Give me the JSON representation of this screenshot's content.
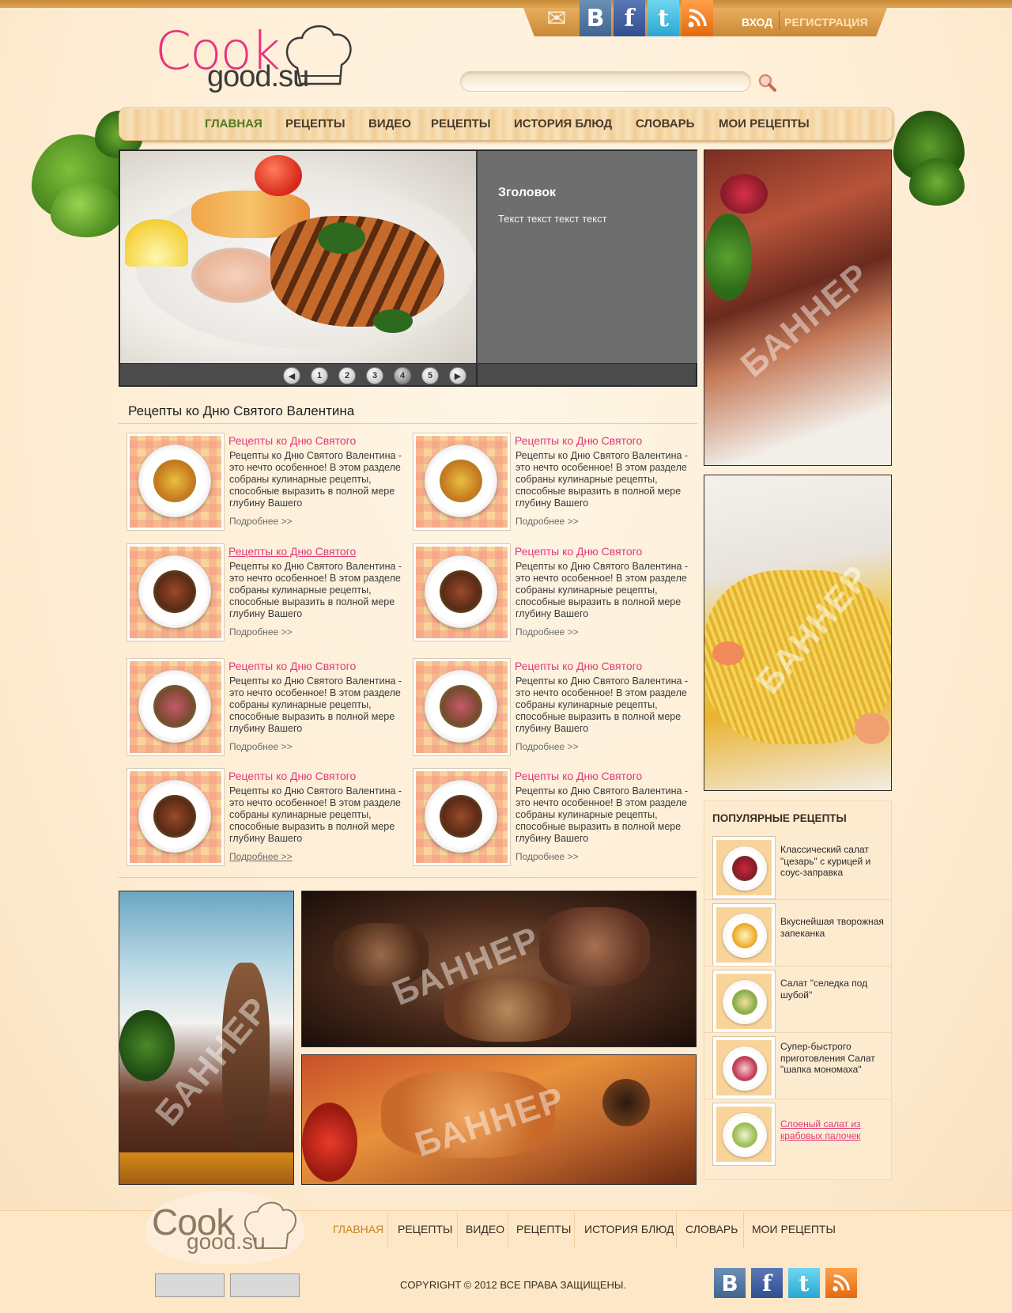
{
  "header": {
    "login": "ВХОД",
    "register": "РЕГИСТРАЦИЯ",
    "logo_cook": "Cook",
    "logo_good": "good.su",
    "social": {
      "vk": "B",
      "fb": "f",
      "tw": "t"
    },
    "search_placeholder": ""
  },
  "nav": [
    "ГЛАВНАЯ",
    "РЕЦЕПТЫ",
    "ВИДЕО",
    "РЕЦЕПТЫ",
    "ИСТОРИЯ БЛЮД",
    "СЛОВАРЬ",
    "МОИ РЕЦЕПТЫ"
  ],
  "slider": {
    "title": "Зголовок",
    "text": "Текст текст текст текст",
    "pages": [
      "1",
      "2",
      "3",
      "4",
      "5"
    ],
    "active_page": "4"
  },
  "banner_label": "БАННЕР",
  "section": {
    "title": "Рецепты ко Дню Святого Валентина",
    "cards": [
      {
        "title": "Рецепты ко Дню Святого",
        "desc": "Рецепты ко Дню Святого Валентина - это нечто особенное! В этом разделе собраны кулинарные рецепты, способные выразить в полной мере глубину Вашего",
        "more": "Подробнее >>"
      },
      {
        "title": "Рецепты ко Дню Святого",
        "desc": "Рецепты ко Дню Святого Валентина - это нечто особенное! В этом разделе собраны кулинарные рецепты, способные выразить в полной мере глубину Вашего",
        "more": "Подробнее >>"
      },
      {
        "title": "Рецепты ко Дню Святого",
        "desc": "Рецепты ко Дню Святого Валентина - это нечто особенное! В этом разделе собраны кулинарные рецепты, способные выразить в полной мере глубину Вашего",
        "more": "Подробнее >>"
      },
      {
        "title": "Рецепты ко Дню Святого",
        "desc": "Рецепты ко Дню Святого Валентина - это нечто особенное! В этом разделе собраны кулинарные рецепты, способные выразить в полной мере глубину Вашего",
        "more": "Подробнее >>"
      },
      {
        "title": "Рецепты ко Дню Святого",
        "desc": "Рецепты ко Дню Святого Валентина - это нечто особенное! В этом разделе собраны кулинарные рецепты, способные выразить в полной мере глубину Вашего",
        "more": "Подробнее >>"
      },
      {
        "title": "Рецепты ко Дню Святого",
        "desc": "Рецепты ко Дню Святого Валентина - это нечто особенное! В этом разделе собраны кулинарные рецепты, способные выразить в полной мере глубину Вашего",
        "more": "Подробнее >>"
      },
      {
        "title": "Рецепты ко Дню Святого",
        "desc": "Рецепты ко Дню Святого Валентина - это нечто особенное! В этом разделе собраны кулинарные рецепты, способные выразить в полной мере глубину Вашего",
        "more": "Подробнее >>"
      },
      {
        "title": "Рецепты ко Дню Святого",
        "desc": "Рецепты ко Дню Святого Валентина - это нечто особенное! В этом разделе собраны кулинарные рецепты, способные выразить в полной мере глубину Вашего",
        "more": "Подробнее >>"
      }
    ]
  },
  "popular": {
    "title": "ПОПУЛЯРНЫЕ РЕЦЕПТЫ",
    "items": [
      "Классический салат \"цезарь\" с курицей и соус-заправка",
      "Вкуснейшая творожная запеканка",
      "Салат \"селедка под шубой\"",
      "Супер-быстрого приготовления Салат \"шапка мономаха\"",
      "Слоеный салат из крабовых палочек"
    ]
  },
  "footer": {
    "logo_cook": "Cook",
    "logo_good": "good.su",
    "nav": [
      "ГЛАВНАЯ",
      "РЕЦЕПТЫ",
      "ВИДЕО",
      "РЕЦЕПТЫ",
      "ИСТОРИЯ БЛЮД",
      "СЛОВАРЬ",
      "МОИ РЕЦЕПТЫ"
    ],
    "copyright": "COPYRIGHT ©   2012   ВСЕ ПРАВА ЗАЩИЩЕНЫ."
  },
  "colors": {
    "accent_pink": "#e0397a",
    "nav_active": "#4d7a20",
    "header_gold": "#c98a36"
  }
}
